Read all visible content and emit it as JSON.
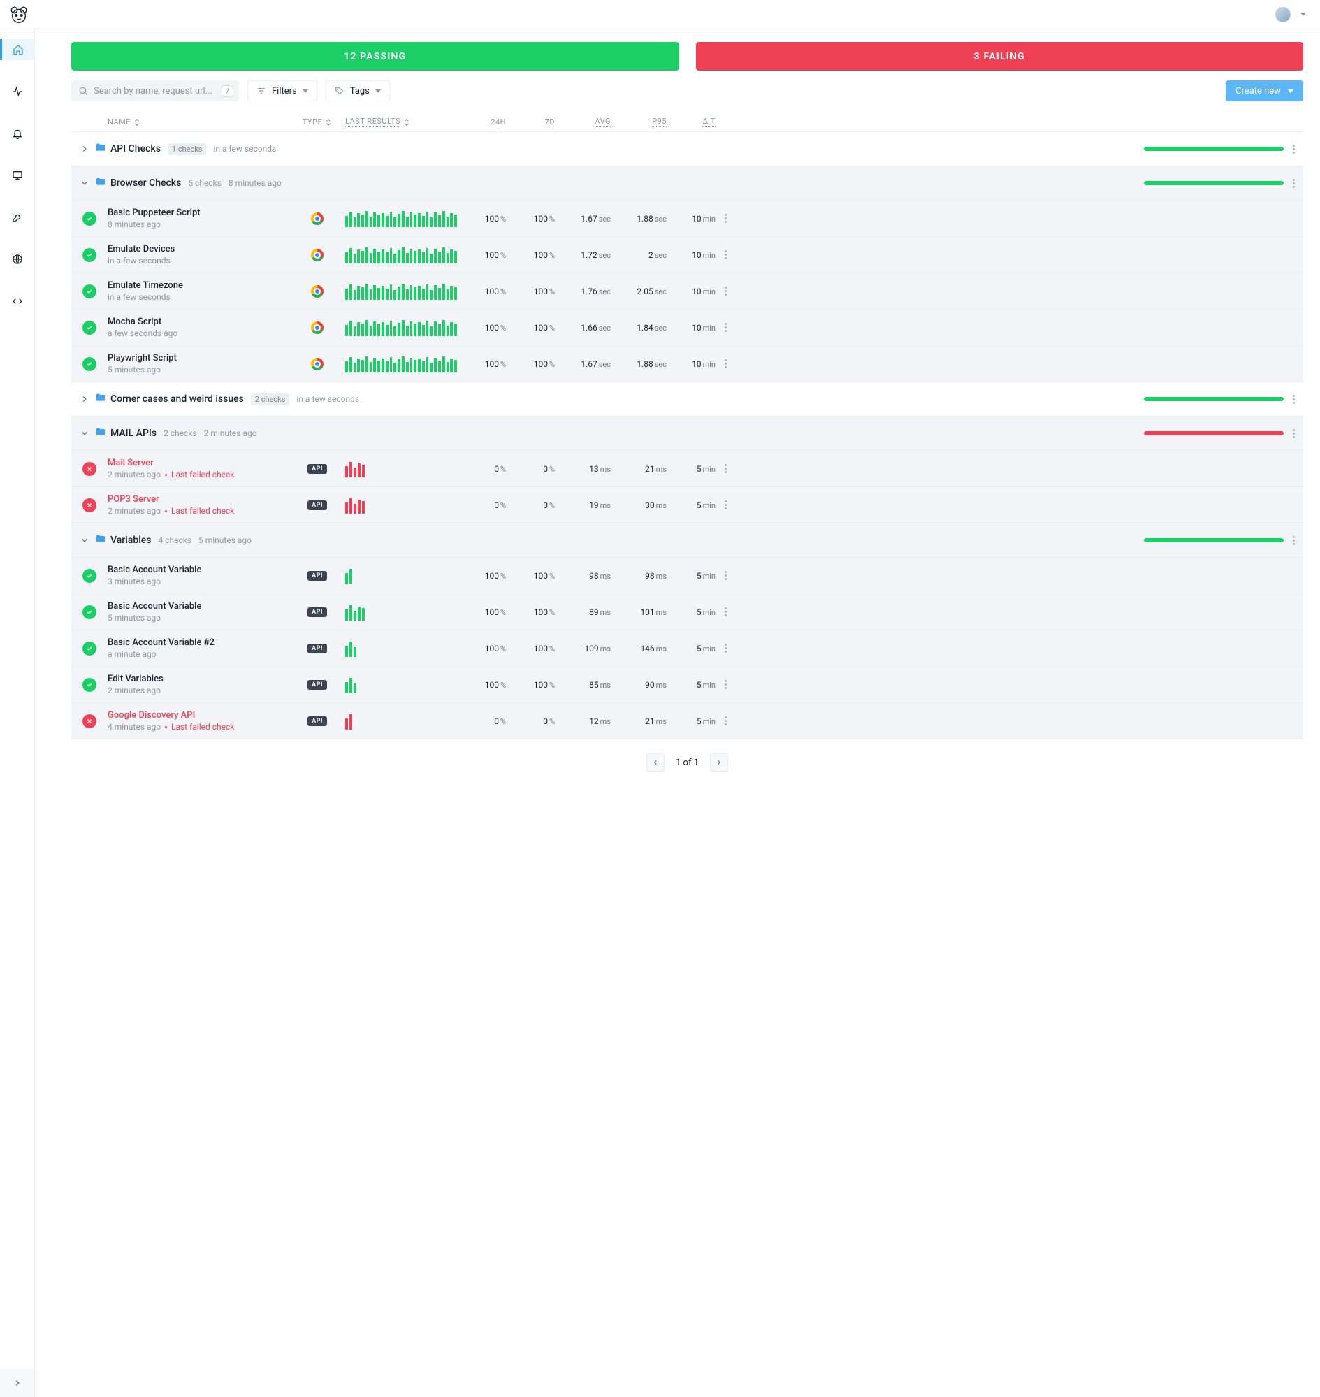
{
  "status": {
    "passing": "12 PASSING",
    "failing": "3 FAILING"
  },
  "toolbar": {
    "search_placeholder": "Search by name, request url...",
    "search_kbd": "/",
    "filters_label": "Filters",
    "tags_label": "Tags",
    "create_label": "Create new"
  },
  "columns": {
    "name": "NAME",
    "type": "TYPE",
    "last_results": "LAST RESULTS",
    "h24": "24H",
    "d7": "7D",
    "avg": "AVG",
    "p95": "P95",
    "dt": "Δ T"
  },
  "sidebar_icons": [
    "home",
    "activity",
    "bell",
    "monitor",
    "tool",
    "globe",
    "code"
  ],
  "groups": [
    {
      "expanded": false,
      "shaded": false,
      "name": "API Checks",
      "count_badge": "1 checks",
      "time": "in a few seconds",
      "bar_color": "green",
      "checks": []
    },
    {
      "expanded": true,
      "shaded": true,
      "name": "Browser Checks",
      "count_text": "5 checks",
      "time": "8 minutes ago",
      "bar_color": "green",
      "checks": [
        {
          "status": "pass",
          "name": "Basic Puppeteer Script",
          "sub": "8 minutes ago",
          "type": "browser",
          "spark": {
            "color": "green",
            "n": 28
          },
          "h24": [
            "100",
            "%"
          ],
          "d7": [
            "100",
            "%"
          ],
          "avg": [
            "1.67",
            "sec"
          ],
          "p95": [
            "1.88",
            "sec"
          ],
          "dt": [
            "10",
            "min"
          ]
        },
        {
          "status": "pass",
          "name": "Emulate Devices",
          "sub": "in a few seconds",
          "type": "browser",
          "spark": {
            "color": "green",
            "n": 28
          },
          "h24": [
            "100",
            "%"
          ],
          "d7": [
            "100",
            "%"
          ],
          "avg": [
            "1.72",
            "sec"
          ],
          "p95": [
            "2",
            "sec"
          ],
          "dt": [
            "10",
            "min"
          ]
        },
        {
          "status": "pass",
          "name": "Emulate Timezone",
          "sub": "in a few seconds",
          "type": "browser",
          "spark": {
            "color": "green",
            "n": 28
          },
          "h24": [
            "100",
            "%"
          ],
          "d7": [
            "100",
            "%"
          ],
          "avg": [
            "1.76",
            "sec"
          ],
          "p95": [
            "2.05",
            "sec"
          ],
          "dt": [
            "10",
            "min"
          ]
        },
        {
          "status": "pass",
          "name": "Mocha Script",
          "sub": "a few seconds ago",
          "type": "browser",
          "spark": {
            "color": "green",
            "n": 28
          },
          "h24": [
            "100",
            "%"
          ],
          "d7": [
            "100",
            "%"
          ],
          "avg": [
            "1.66",
            "sec"
          ],
          "p95": [
            "1.84",
            "sec"
          ],
          "dt": [
            "10",
            "min"
          ]
        },
        {
          "status": "pass",
          "name": "Playwright Script",
          "sub": "5 minutes ago",
          "type": "browser",
          "spark": {
            "color": "green",
            "n": 28
          },
          "h24": [
            "100",
            "%"
          ],
          "d7": [
            "100",
            "%"
          ],
          "avg": [
            "1.67",
            "sec"
          ],
          "p95": [
            "1.88",
            "sec"
          ],
          "dt": [
            "10",
            "min"
          ]
        }
      ]
    },
    {
      "expanded": false,
      "shaded": false,
      "name": "Corner cases and weird issues",
      "count_badge": "2 checks",
      "time": "in a few seconds",
      "bar_color": "green",
      "checks": []
    },
    {
      "expanded": true,
      "shaded": true,
      "name": "MAIL APIs",
      "count_text": "2 checks",
      "time": "2 minutes ago",
      "bar_color": "red",
      "checks": [
        {
          "status": "fail",
          "name": "Mail Server",
          "sub": "2 minutes ago",
          "last_failed": "Last failed check",
          "type": "api",
          "spark": {
            "color": "red",
            "n": 5
          },
          "h24": [
            "0",
            "%"
          ],
          "d7": [
            "0",
            "%"
          ],
          "avg": [
            "13",
            "ms"
          ],
          "p95": [
            "21",
            "ms"
          ],
          "dt": [
            "5",
            "min"
          ]
        },
        {
          "status": "fail",
          "name": "POP3 Server",
          "sub": "2 minutes ago",
          "last_failed": "Last failed check",
          "type": "api",
          "spark": {
            "color": "red",
            "n": 5
          },
          "h24": [
            "0",
            "%"
          ],
          "d7": [
            "0",
            "%"
          ],
          "avg": [
            "19",
            "ms"
          ],
          "p95": [
            "30",
            "ms"
          ],
          "dt": [
            "5",
            "min"
          ]
        }
      ]
    },
    {
      "expanded": true,
      "shaded": true,
      "name": "Variables",
      "count_text": "4 checks",
      "time": "5 minutes ago",
      "bar_color": "green",
      "checks": [
        {
          "status": "pass",
          "name": "Basic Account Variable",
          "sub": "3 minutes ago",
          "type": "api",
          "spark": {
            "color": "green",
            "n": 2
          },
          "h24": [
            "100",
            "%"
          ],
          "d7": [
            "100",
            "%"
          ],
          "avg": [
            "98",
            "ms"
          ],
          "p95": [
            "98",
            "ms"
          ],
          "dt": [
            "5",
            "min"
          ]
        },
        {
          "status": "pass",
          "name": "Basic Account Variable",
          "sub": "5 minutes ago",
          "type": "api",
          "spark": {
            "color": "green",
            "n": 5
          },
          "h24": [
            "100",
            "%"
          ],
          "d7": [
            "100",
            "%"
          ],
          "avg": [
            "89",
            "ms"
          ],
          "p95": [
            "101",
            "ms"
          ],
          "dt": [
            "5",
            "min"
          ]
        },
        {
          "status": "pass",
          "name": "Basic Account Variable #2",
          "sub": "a minute ago",
          "type": "api",
          "spark": {
            "color": "green",
            "n": 3
          },
          "h24": [
            "100",
            "%"
          ],
          "d7": [
            "100",
            "%"
          ],
          "avg": [
            "109",
            "ms"
          ],
          "p95": [
            "146",
            "ms"
          ],
          "dt": [
            "5",
            "min"
          ]
        },
        {
          "status": "pass",
          "name": "Edit Variables",
          "sub": "2 minutes ago",
          "type": "api",
          "spark": {
            "color": "green",
            "n": 3
          },
          "h24": [
            "100",
            "%"
          ],
          "d7": [
            "100",
            "%"
          ],
          "avg": [
            "85",
            "ms"
          ],
          "p95": [
            "90",
            "ms"
          ],
          "dt": [
            "5",
            "min"
          ]
        },
        {
          "status": "fail",
          "name": "Google Discovery API",
          "sub": "4 minutes ago",
          "last_failed": "Last failed check",
          "type": "api",
          "spark": {
            "color": "red",
            "n": 2
          },
          "h24": [
            "0",
            "%"
          ],
          "d7": [
            "0",
            "%"
          ],
          "avg": [
            "12",
            "ms"
          ],
          "p95": [
            "21",
            "ms"
          ],
          "dt": [
            "5",
            "min"
          ]
        }
      ]
    }
  ],
  "pagination": {
    "text": "1 of 1"
  },
  "api_badge_text": "API"
}
